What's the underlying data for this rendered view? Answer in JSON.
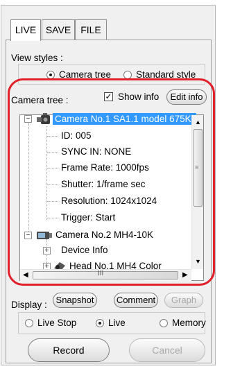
{
  "tabs": [
    {
      "label": "LIVE"
    },
    {
      "label": "SAVE"
    },
    {
      "label": "FILE"
    }
  ],
  "view_styles": {
    "label": "View styles :",
    "camera_tree_option": "Camera tree",
    "standard_style_option": "Standard style",
    "selected": "Camera tree"
  },
  "camera_tree": {
    "label": "Camera tree :",
    "show_info_label": "Show info",
    "show_info_checked": true,
    "edit_info_button": "Edit info",
    "nodes": {
      "camera1": "Camera No.1 SA1.1 model 675K-",
      "id": "ID: 005",
      "sync": "SYNC IN: NONE",
      "frame_rate": "Frame Rate: 1000fps",
      "shutter": "Shutter: 1/frame sec",
      "resolution": "Resolution: 1024x1024",
      "trigger": "Trigger: Start",
      "camera2": "Camera No.2 MH4-10K",
      "device_info": "Device Info",
      "head1": "Head No.1 MH4 Color"
    },
    "hscroll_glyph": "III"
  },
  "actions": {
    "snapshot": "Snapshot",
    "comment": "Comment",
    "graph": "Graph"
  },
  "display": {
    "label": "Display :",
    "live_stop": "Live Stop",
    "live": "Live",
    "memory": "Memory",
    "selected": "Live"
  },
  "buttons": {
    "record": "Record",
    "cancel": "Cancel"
  },
  "colors": {
    "highlight": "#3399ff",
    "outline": "#e0202b"
  }
}
